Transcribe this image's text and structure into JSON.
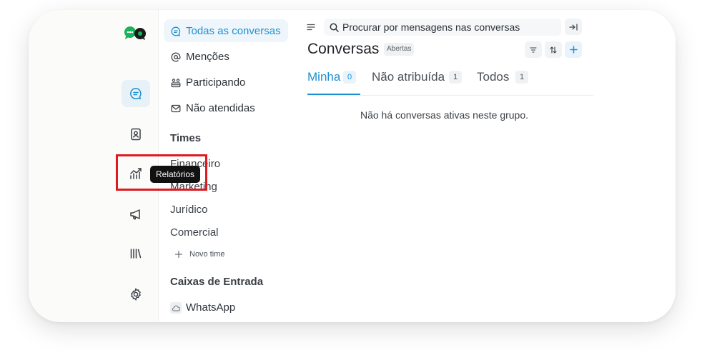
{
  "sidebar_nav": {
    "all_conversations": "Todas as conversas",
    "mentions": "Menções",
    "participating": "Participando",
    "unattended": "Não atendidas"
  },
  "teams": {
    "title": "Times",
    "items": [
      "Financeiro",
      "Marketing",
      "Jurídico",
      "Comercial"
    ],
    "new_team": "Novo time"
  },
  "inboxes": {
    "title": "Caixas de Entrada",
    "items": [
      "WhatsApp"
    ]
  },
  "search": {
    "placeholder": "Procurar por mensagens nas conversas"
  },
  "header": {
    "title": "Conversas",
    "status_badge": "Abertas"
  },
  "tabs": [
    {
      "label": "Minha",
      "count": "0"
    },
    {
      "label": "Não atribuída",
      "count": "1"
    },
    {
      "label": "Todos",
      "count": "1"
    }
  ],
  "empty_state": "Não há conversas ativas neste grupo.",
  "tooltip": "Relatórios",
  "colors": {
    "accent": "#1f8fcf",
    "highlight_border": "#e0191f",
    "logo_green": "#16b35a"
  },
  "icons": {
    "rail": [
      "conversations-icon",
      "contacts-icon",
      "reports-icon",
      "campaigns-icon",
      "library-icon",
      "settings-icon"
    ]
  }
}
